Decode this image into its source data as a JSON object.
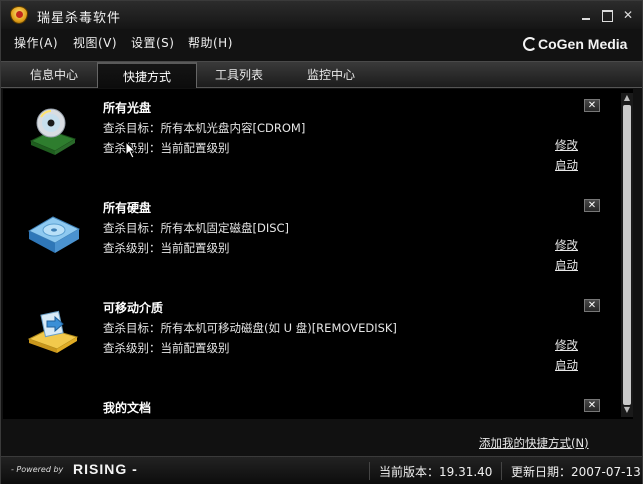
{
  "window": {
    "title": "瑞星杀毒软件",
    "minimize": "",
    "maximize": "",
    "close": "✕"
  },
  "menu": {
    "items": [
      {
        "label": "操作(A)"
      },
      {
        "label": "视图(V)"
      },
      {
        "label": "设置(S)"
      },
      {
        "label": "帮助(H)"
      }
    ],
    "brand": "CoGen Media"
  },
  "tabs": [
    {
      "label": "信息中心",
      "active": false
    },
    {
      "label": "快捷方式",
      "active": true
    },
    {
      "label": "工具列表",
      "active": false
    },
    {
      "label": "监控中心",
      "active": false
    }
  ],
  "shortcuts": [
    {
      "title": "所有光盘",
      "target": "查杀目标：所有本机光盘内容[CDROM]",
      "level": "查杀级别：当前配置级别",
      "icon": "cdrom-drive-icon",
      "edit": "修改",
      "start": "启动",
      "close": "✕"
    },
    {
      "title": "所有硬盘",
      "target": "查杀目标：所有本机固定磁盘[DISC]",
      "level": "查杀级别：当前配置级别",
      "icon": "hard-disk-icon",
      "edit": "修改",
      "start": "启动",
      "close": "✕"
    },
    {
      "title": "可移动介质",
      "target": "查杀目标：所有本机可移动磁盘(如 U 盘)[REMOVEDISK]",
      "level": "查杀级别：当前配置级别",
      "icon": "removable-media-icon",
      "edit": "修改",
      "start": "启动",
      "close": "✕"
    },
    {
      "title": "我的文档",
      "target": "",
      "level": "",
      "icon": "my-documents-icon",
      "edit": "",
      "start": "",
      "close": "✕"
    }
  ],
  "add_shortcut": "添加我的快捷方式(N)",
  "status": {
    "powered_by": "- Powered by",
    "brand": "RISING -",
    "version": "当前版本：19.31.40",
    "update_date": "更新日期：2007-07-13"
  },
  "colors": {
    "background": "#000000",
    "chrome": "#1c1c1c",
    "text": "#e8e8e8"
  }
}
